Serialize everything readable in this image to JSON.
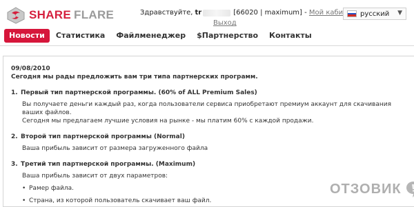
{
  "header": {
    "logo_primary": "SHARE",
    "logo_secondary": "FLARE",
    "greeting": "Здравствуйте,",
    "username": "tr",
    "account_info": "[66020 | maximum] -",
    "cabinet_link": "Мой кабинет",
    "bracket_close": "|",
    "logout_link": "Выход",
    "language": "русский"
  },
  "nav": {
    "items": [
      "Новости",
      "Статистика",
      "Файлменеджер",
      "$Партнерство",
      "Контакты"
    ],
    "active": "Новости"
  },
  "content": {
    "date": "09/08/2010",
    "intro": "Сегодня мы рады предложить вам три типа партнерских программ.",
    "programs": [
      {
        "num": "1.",
        "title": "Первый тип партнерской программы. (60% of ALL Premium Sales)",
        "desc1": "Вы получаете деньги каждый раз, когда пользователи сервиса приобретают премиум аккаунт для скачивания ваших файлов.",
        "desc2": "Сегодня мы предлагаем лучшие условия на рынке - мы платим 60% с каждой продажи."
      },
      {
        "num": "2.",
        "title": "Второй тип партнерской программы (Normal)",
        "desc1": "Ваша прибыль зависит от размера загруженного файла"
      },
      {
        "num": "3.",
        "title": "Третий тип партнерской программы. (Maximum)",
        "desc1": "Ваша прибыль зависит от двух параметров:",
        "bullets": [
          "Рамер файла.",
          "Страна, из которой пользователь скачивает ваш файл."
        ]
      }
    ]
  },
  "watermark": {
    "text": "ОТЗОВИК"
  },
  "colors": {
    "brand_red": "#d6163b",
    "logo_gray": "#9a9a9a"
  }
}
